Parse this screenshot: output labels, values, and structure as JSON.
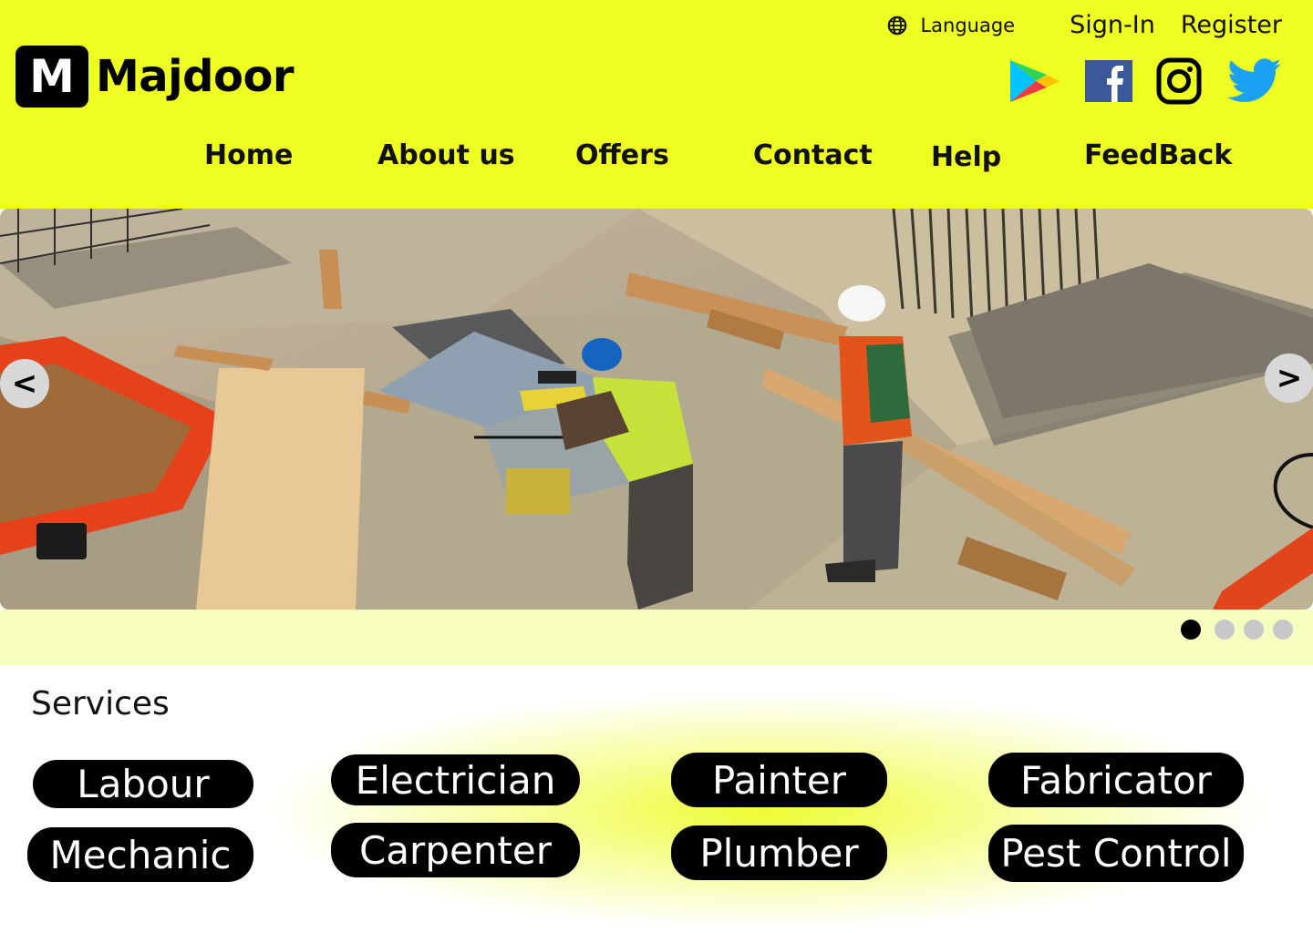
{
  "brand": {
    "logo_letter": "M",
    "name": "Majdoor"
  },
  "top_links": {
    "language": "Language",
    "sign_in": "Sign-In",
    "register": "Register"
  },
  "social_icons": [
    "google-play-icon",
    "facebook-icon",
    "instagram-icon",
    "twitter-icon"
  ],
  "nav": [
    "Home",
    "About us",
    "Offers",
    "Contact",
    "Help",
    "FeedBack"
  ],
  "carousel": {
    "prev": "<",
    "next": ">",
    "slides": 4,
    "active_index": 0
  },
  "services": {
    "title": "Services",
    "items": [
      "Labour",
      "Electrician",
      "Painter",
      "Fabricator",
      "Mechanic",
      "Carpenter",
      "Plumber",
      "Pest Control"
    ]
  },
  "colors": {
    "header": "#eefd22",
    "band": "#f8fec0",
    "pill": "#000000",
    "dot_active": "#000000",
    "dot_inactive": "#c8c8c8"
  }
}
